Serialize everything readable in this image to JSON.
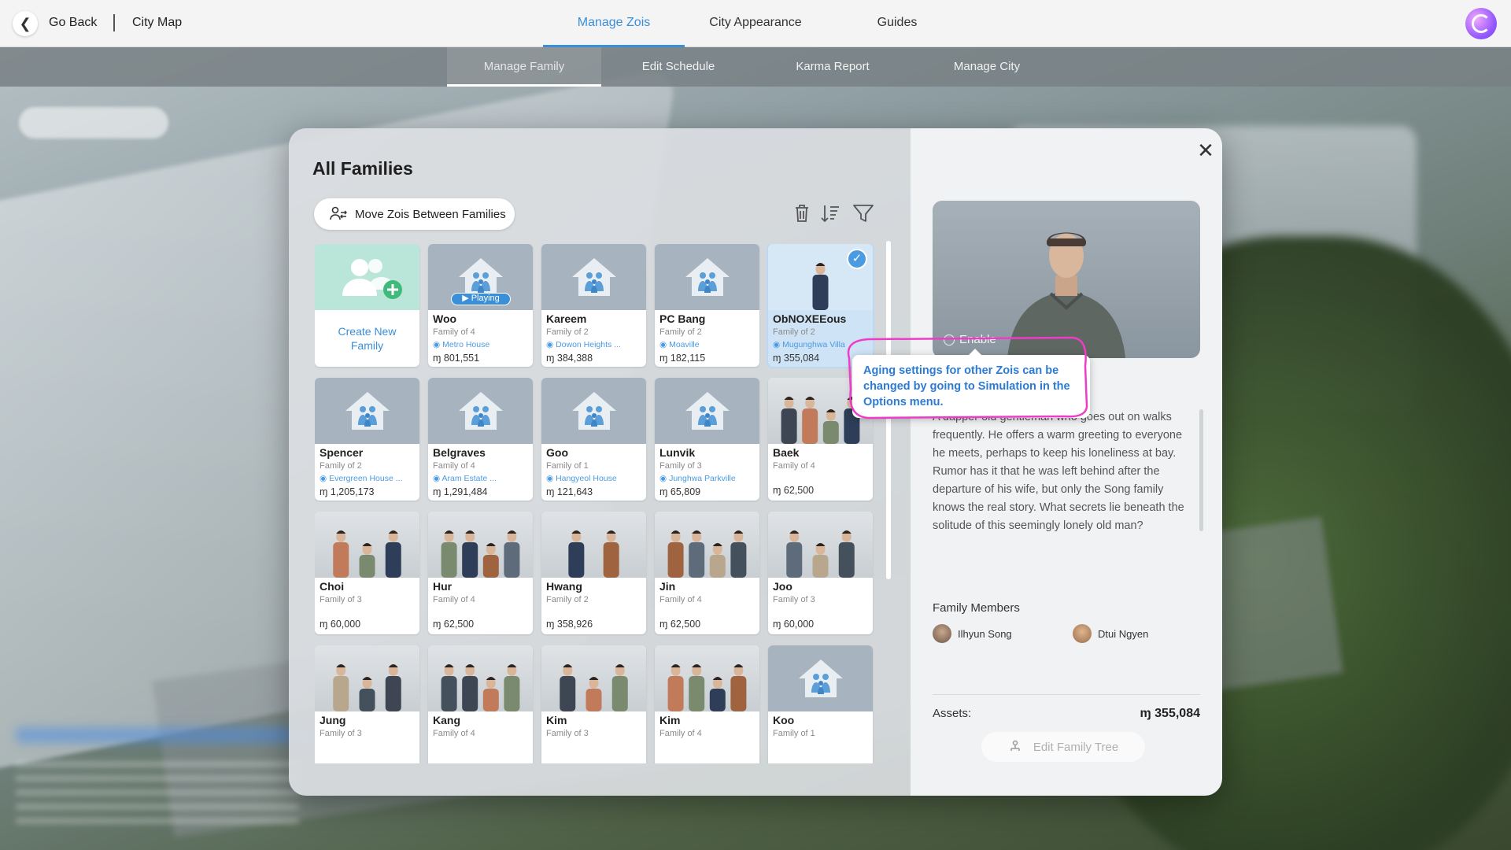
{
  "topbar": {
    "back_label": "Go Back",
    "city_map_label": "City Map",
    "tabs": [
      {
        "label": "Manage Zois",
        "active": true
      },
      {
        "label": "City Appearance",
        "active": false
      },
      {
        "label": "Guides",
        "active": false
      }
    ],
    "accent_color": "#3a8fd8"
  },
  "subnav": {
    "tabs": [
      {
        "label": "Manage Family",
        "active": true
      },
      {
        "label": "Edit Schedule",
        "active": false
      },
      {
        "label": "Karma Report",
        "active": false
      },
      {
        "label": "Manage City",
        "active": false
      }
    ]
  },
  "families_panel": {
    "title": "All Families",
    "move_button": "Move Zois Between Families",
    "toolbar_icons": [
      "trash-icon",
      "sort-icon",
      "filter-icon"
    ],
    "create_card": {
      "line1": "Create New",
      "line2": "Family"
    },
    "playing_badge": "Playing",
    "cards": [
      {
        "name": "Woo",
        "size": "Family of 4",
        "location": "Metro House",
        "money": "ɱ 801,551",
        "thumb": "house",
        "playing": true
      },
      {
        "name": "Kareem",
        "size": "Family of 2",
        "location": "Dowon Heights ...",
        "money": "ɱ 384,388",
        "thumb": "house"
      },
      {
        "name": "PC Bang",
        "size": "Family of 2",
        "location": "Moaville",
        "money": "ɱ 182,115",
        "thumb": "house"
      },
      {
        "name": "ObNOXEEous",
        "size": "Family of 2",
        "location": "Mugunghwa Villa",
        "money": "ɱ 355,084",
        "thumb": "photo",
        "selected": true
      },
      {
        "name": "Spencer",
        "size": "Family of 2",
        "location": "Evergreen House ...",
        "money": "ɱ 1,205,173",
        "thumb": "house"
      },
      {
        "name": "Belgraves",
        "size": "Family of 4",
        "location": "Aram Estate ...",
        "money": "ɱ 1,291,484",
        "thumb": "house"
      },
      {
        "name": "Goo",
        "size": "Family of 1",
        "location": "Hangyeol House",
        "money": "ɱ 121,643",
        "thumb": "house"
      },
      {
        "name": "Lunvik",
        "size": "Family of 3",
        "location": "Junghwa Parkville",
        "money": "ɱ 65,809",
        "thumb": "house"
      },
      {
        "name": "Baek",
        "size": "Family of 4",
        "location": "",
        "money": "ɱ 62,500",
        "thumb": "photo"
      },
      {
        "name": "Choi",
        "size": "Family of 3",
        "location": "",
        "money": "ɱ 60,000",
        "thumb": "photo"
      },
      {
        "name": "Hur",
        "size": "Family of 4",
        "location": "",
        "money": "ɱ 62,500",
        "thumb": "photo"
      },
      {
        "name": "Hwang",
        "size": "Family of 2",
        "location": "",
        "money": "ɱ 358,926",
        "thumb": "photo"
      },
      {
        "name": "Jin",
        "size": "Family of 4",
        "location": "",
        "money": "ɱ 62,500",
        "thumb": "photo"
      },
      {
        "name": "Joo",
        "size": "Family of 3",
        "location": "",
        "money": "ɱ 60,000",
        "thumb": "photo"
      },
      {
        "name": "Jung",
        "size": "Family of 3",
        "location": "",
        "money": "",
        "thumb": "photo"
      },
      {
        "name": "Kang",
        "size": "Family of 4",
        "location": "",
        "money": "",
        "thumb": "photo"
      },
      {
        "name": "Kim",
        "size": "Family of 3",
        "location": "",
        "money": "",
        "thumb": "photo"
      },
      {
        "name": "Kim",
        "size": "Family of 4",
        "location": "",
        "money": "",
        "thumb": "photo"
      },
      {
        "name": "Koo",
        "size": "Family of 1",
        "location": "",
        "money": "",
        "thumb": "house"
      }
    ]
  },
  "detail_panel": {
    "enable_label": "Enable",
    "tooltip": "Aging settings for other Zois can be changed by going to Simulation in the Options menu.",
    "description": "A dapper old gentleman who goes out on walks frequently. He offers a warm greeting to everyone he meets, perhaps to keep his loneliness at bay. Rumor has it that he was left behind after the departure of his wife, but only the Song family knows the real story. What secrets lie beneath the solitude of this seemingly lonely old man?",
    "family_members_label": "Family Members",
    "members": [
      {
        "name": "Ilhyun Song"
      },
      {
        "name": "Dtui Ngyen"
      }
    ],
    "assets_label": "Assets:",
    "assets_value": "ɱ 355,084",
    "edit_tree_label": "Edit Family Tree"
  }
}
